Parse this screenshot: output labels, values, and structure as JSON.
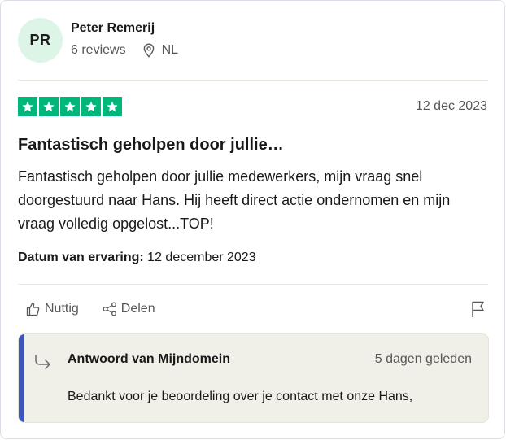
{
  "reviewer": {
    "initials": "PR",
    "name": "Peter Remerij",
    "reviews_count": "6 reviews",
    "country": "NL"
  },
  "review": {
    "rating": 5,
    "star_color": "#00b67a",
    "date": "12 dec 2023",
    "title": "Fantastisch geholpen door jullie…",
    "body": "Fantastisch geholpen door jullie medewerkers, mijn vraag snel doorgestuurd naar Hans. Hij heeft direct actie ondernomen en mijn vraag volledig opgelost...TOP!",
    "experience_label": "Datum van ervaring:",
    "experience_date": "12 december 2023"
  },
  "actions": {
    "useful_label": "Nuttig",
    "share_label": "Delen",
    "icons": [
      "thumbs-up-icon",
      "share-icon",
      "flag-icon"
    ]
  },
  "reply": {
    "title": "Antwoord van Mijndomein",
    "date": "5 dagen geleden",
    "text": "Bedankt voor je beoordeling over je contact met onze Hans,",
    "accent_color": "#3c57bc",
    "icon": "reply-arrow-icon"
  }
}
